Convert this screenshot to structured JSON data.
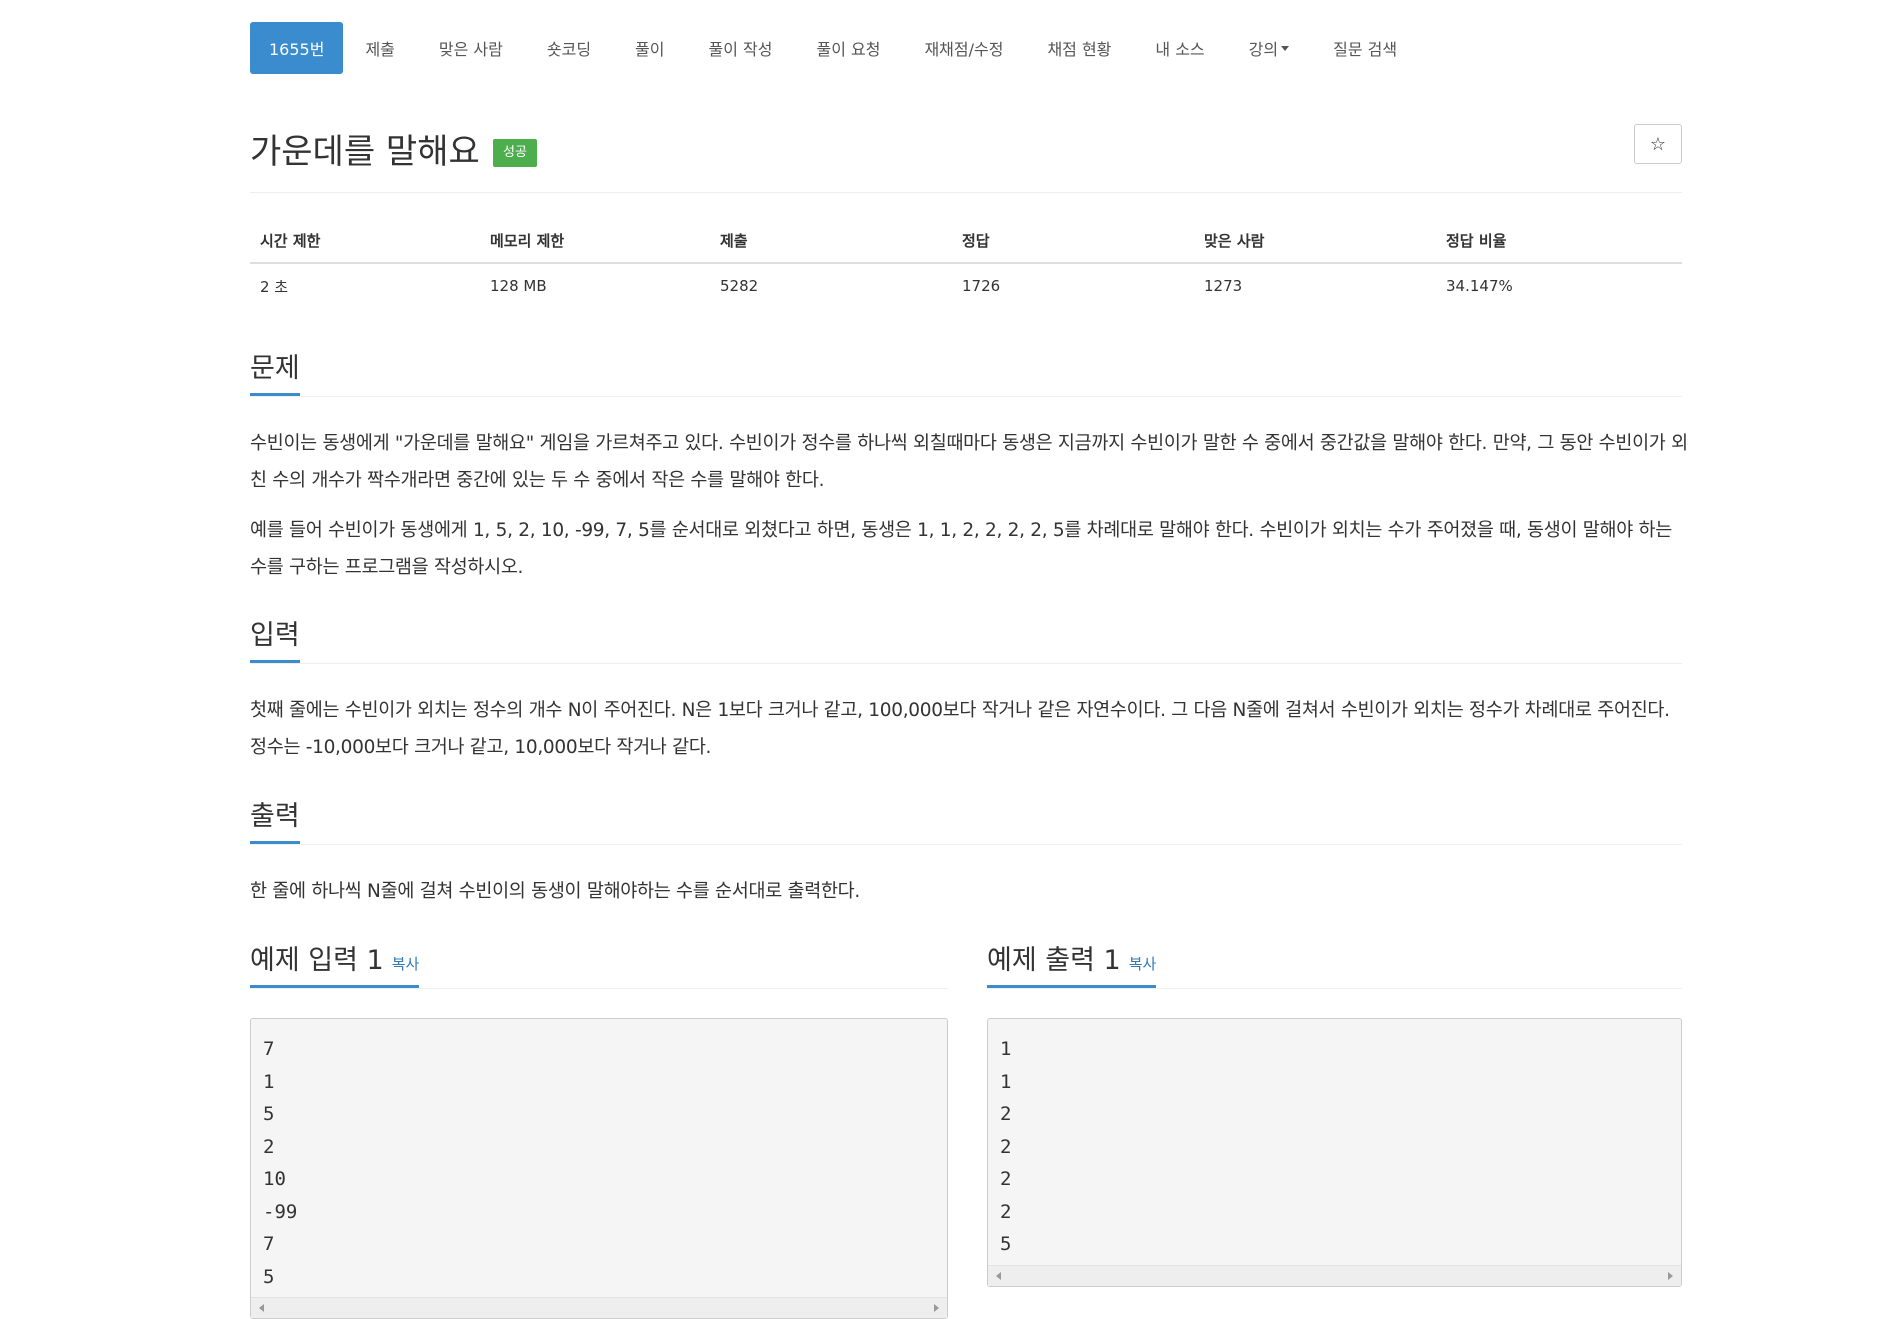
{
  "tabs": [
    {
      "label": "1655번",
      "active": true
    },
    {
      "label": "제출"
    },
    {
      "label": "맞은 사람"
    },
    {
      "label": "숏코딩"
    },
    {
      "label": "풀이"
    },
    {
      "label": "풀이 작성"
    },
    {
      "label": "풀이 요청"
    },
    {
      "label": "재채점/수정"
    },
    {
      "label": "채점 현황"
    },
    {
      "label": "내 소스"
    },
    {
      "label": "강의"
    },
    {
      "label": "질문 검색"
    }
  ],
  "problem": {
    "title": "가운데를 말해요",
    "status_badge": "성공",
    "star_icon": "☆"
  },
  "stats": {
    "headers": [
      "시간 제한",
      "메모리 제한",
      "제출",
      "정답",
      "맞은 사람",
      "정답 비율"
    ],
    "values": [
      "2 초",
      "128 MB",
      "5282",
      "1726",
      "1273",
      "34.147%"
    ]
  },
  "sections": {
    "description": {
      "heading": "문제",
      "paragraphs": [
        "수빈이는 동생에게 \"가운데를 말해요\" 게임을 가르쳐주고 있다. 수빈이가 정수를 하나씩 외칠때마다 동생은 지금까지 수빈이가 말한 수 중에서 중간값을 말해야 한다. 만약, 그 동안 수빈이가 외친 수의 개수가 짝수개라면 중간에 있는 두 수 중에서 작은 수를 말해야 한다.",
        "예를 들어 수빈이가 동생에게 1, 5, 2, 10, -99, 7, 5를 순서대로 외쳤다고 하면, 동생은 1, 1, 2, 2, 2, 2, 5를 차례대로 말해야 한다. 수빈이가 외치는 수가 주어졌을 때, 동생이 말해야 하는 수를 구하는 프로그램을 작성하시오."
      ]
    },
    "input": {
      "heading": "입력",
      "text": "첫째 줄에는 수빈이가 외치는 정수의 개수 N이 주어진다. N은 1보다 크거나 같고, 100,000보다 작거나 같은 자연수이다. 그 다음 N줄에 걸쳐서 수빈이가 외치는 정수가 차례대로 주어진다. 정수는 -10,000보다 크거나 같고, 10,000보다 작거나 같다."
    },
    "output": {
      "heading": "출력",
      "text": "한 줄에 하나씩 N줄에 걸쳐 수빈이의 동생이 말해야하는 수를 순서대로 출력한다."
    },
    "sample_input": {
      "heading": "예제 입력 1",
      "copy_label": "복사",
      "content": "7\n1\n5\n2\n10\n-99\n7\n5"
    },
    "sample_output": {
      "heading": "예제 출력 1",
      "copy_label": "복사",
      "content": "1\n1\n2\n2\n2\n2\n5"
    }
  }
}
